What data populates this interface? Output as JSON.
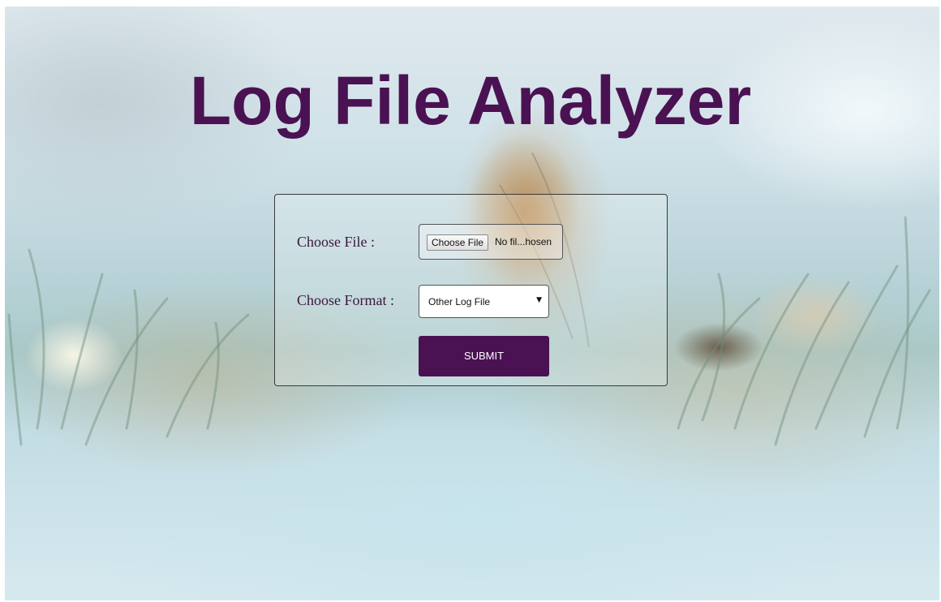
{
  "page": {
    "title": "Log File Analyzer"
  },
  "form": {
    "file_label": "Choose File :",
    "file_button_label": "Choose File",
    "file_status": "No fil...hosen",
    "format_label": "Choose Format :",
    "format_selected": "Other Log File",
    "format_caret": "▼",
    "submit_label": "SUBMIT"
  },
  "colors": {
    "accent": "#4a1252",
    "label_text": "#3b1540"
  },
  "icons": {
    "dropdown": "chevron-down-icon"
  }
}
